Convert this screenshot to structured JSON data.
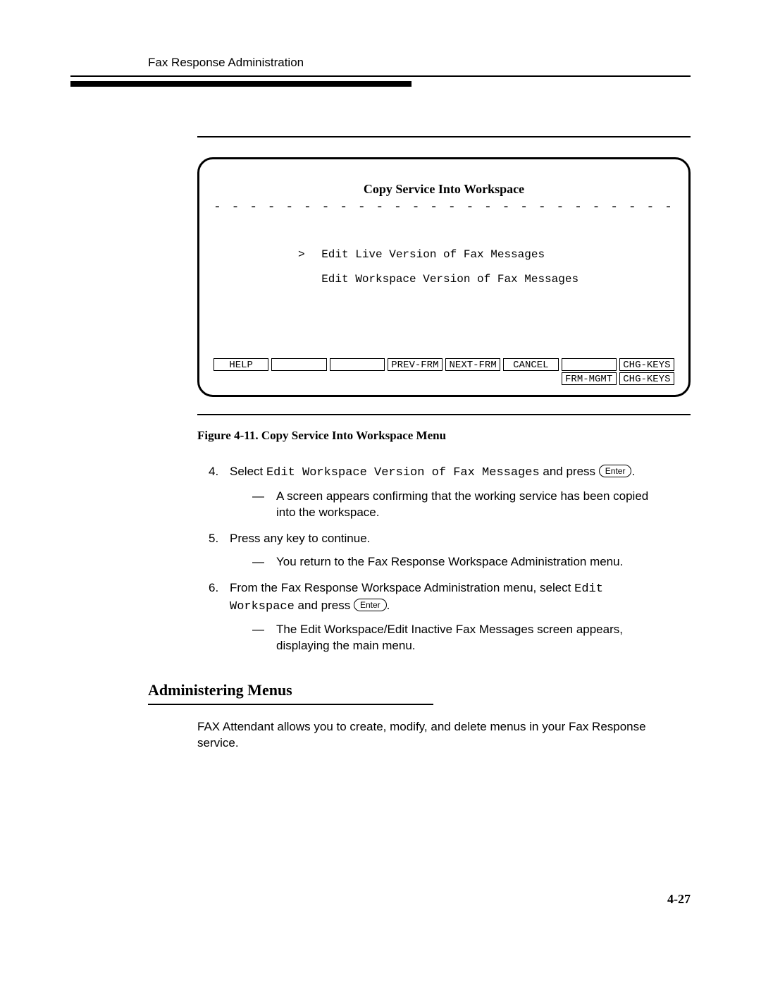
{
  "header": {
    "running_title": "Fax Response Administration"
  },
  "figure": {
    "screen_title": "Copy Service Into Workspace",
    "dashes": "- - - - - - - - - - - - - - - - - - - - - - - - - - - - - - -",
    "menu_items": [
      {
        "cursor": ">",
        "label": "Edit Live Version of Fax Messages"
      },
      {
        "cursor": " ",
        "label": "Edit Workspace Version of Fax Messages"
      }
    ],
    "fn_row1": [
      "HELP",
      "",
      "",
      "PREV-FRM",
      "NEXT-FRM",
      "CANCEL",
      "",
      "CHG-KEYS"
    ],
    "fn_row2": [
      "",
      "",
      "",
      "",
      "",
      "",
      "FRM-MGMT",
      "CHG-KEYS"
    ],
    "caption": "Figure 4-11.  Copy Service Into Workspace Menu"
  },
  "steps": {
    "s4": {
      "num": "4.",
      "pre": "Select ",
      "mono": "Edit Workspace Version of Fax Messages",
      "post": " and press ",
      "key": "Enter",
      "tail": ".",
      "sub1": "A screen appears confirming that the working service has been copied into the workspace."
    },
    "s5": {
      "num": "5.",
      "text": "Press any key to continue.",
      "sub1": "You return to the Fax Response Workspace Administration menu."
    },
    "s6": {
      "num": "6.",
      "pre": "From the Fax Response Workspace Administration menu, select ",
      "mono1": "Edit Workspace",
      "mid": " and press ",
      "key": "Enter",
      "tail": ".",
      "sub1": "The Edit Workspace/Edit Inactive Fax Messages screen appears, displaying the main menu."
    }
  },
  "section": {
    "title": "Administering Menus",
    "para": "FAX Attendant allows you to create, modify, and delete menus in your Fax Response service."
  },
  "page_number": "4-27"
}
